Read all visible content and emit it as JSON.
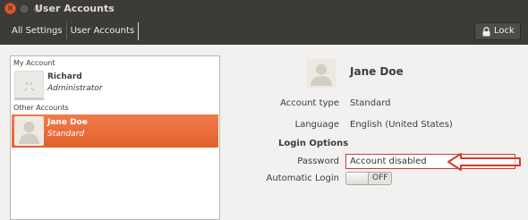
{
  "window": {
    "title": "User Accounts"
  },
  "toolbar": {
    "crumbs": [
      "All Settings",
      "User Accounts"
    ],
    "lock_label": "Lock"
  },
  "accounts": {
    "my_account_label": "My Account",
    "other_accounts_label": "Other Accounts",
    "users": [
      {
        "name": "Richard",
        "role": "Administrator",
        "selected": false
      },
      {
        "name": "Jane Doe",
        "role": "Standard",
        "selected": true
      }
    ]
  },
  "details": {
    "name": "Jane Doe",
    "account_type_label": "Account type",
    "account_type_value": "Standard",
    "language_label": "Language",
    "language_value": "English (United States)",
    "login_options_label": "Login Options",
    "password_label": "Password",
    "password_value": "Account disabled",
    "autologin_label": "Automatic Login",
    "autologin_state": "OFF"
  },
  "colors": {
    "accent": "#e9682f",
    "annotation": "#d23a2a",
    "titlebar": "#3c3b37"
  }
}
